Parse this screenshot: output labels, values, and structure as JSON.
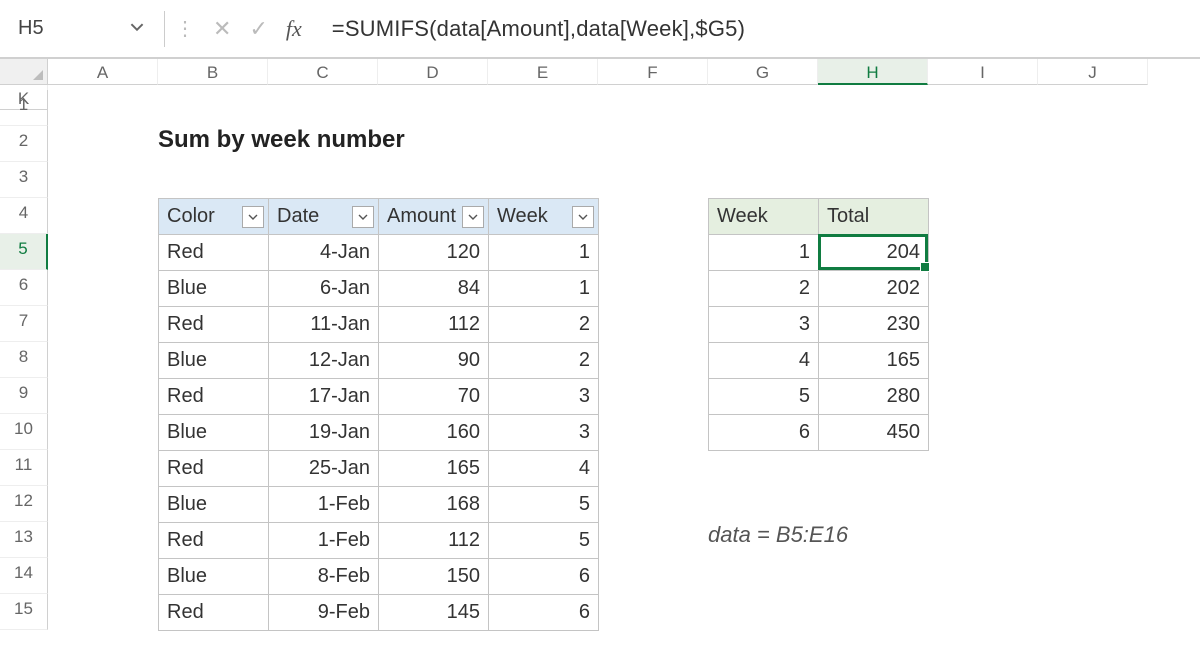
{
  "activeCell": "H5",
  "formula": "=SUMIFS(data[Amount],data[Week],$G5)",
  "pageTitle": "Sum by week number",
  "columns": [
    "A",
    "B",
    "C",
    "D",
    "E",
    "F",
    "G",
    "H",
    "I",
    "J",
    "K"
  ],
  "activeCol": "H",
  "rowCount": 15,
  "activeRow": 5,
  "dataTable": {
    "headers": [
      "Color",
      "Date",
      "Amount",
      "Week"
    ],
    "rows": [
      {
        "color": "Red",
        "date": "4-Jan",
        "amount": "120",
        "week": "1"
      },
      {
        "color": "Blue",
        "date": "6-Jan",
        "amount": "84",
        "week": "1"
      },
      {
        "color": "Red",
        "date": "11-Jan",
        "amount": "112",
        "week": "2"
      },
      {
        "color": "Blue",
        "date": "12-Jan",
        "amount": "90",
        "week": "2"
      },
      {
        "color": "Red",
        "date": "17-Jan",
        "amount": "70",
        "week": "3"
      },
      {
        "color": "Blue",
        "date": "19-Jan",
        "amount": "160",
        "week": "3"
      },
      {
        "color": "Red",
        "date": "25-Jan",
        "amount": "165",
        "week": "4"
      },
      {
        "color": "Blue",
        "date": "1-Feb",
        "amount": "168",
        "week": "5"
      },
      {
        "color": "Red",
        "date": "1-Feb",
        "amount": "112",
        "week": "5"
      },
      {
        "color": "Blue",
        "date": "8-Feb",
        "amount": "150",
        "week": "6"
      },
      {
        "color": "Red",
        "date": "9-Feb",
        "amount": "145",
        "week": "6"
      }
    ]
  },
  "summaryTable": {
    "headers": [
      "Week",
      "Total"
    ],
    "rows": [
      {
        "week": "1",
        "total": "204"
      },
      {
        "week": "2",
        "total": "202"
      },
      {
        "week": "3",
        "total": "230"
      },
      {
        "week": "4",
        "total": "165"
      },
      {
        "week": "5",
        "total": "280"
      },
      {
        "week": "6",
        "total": "450"
      }
    ]
  },
  "rangeNote": "data = B5:E16"
}
